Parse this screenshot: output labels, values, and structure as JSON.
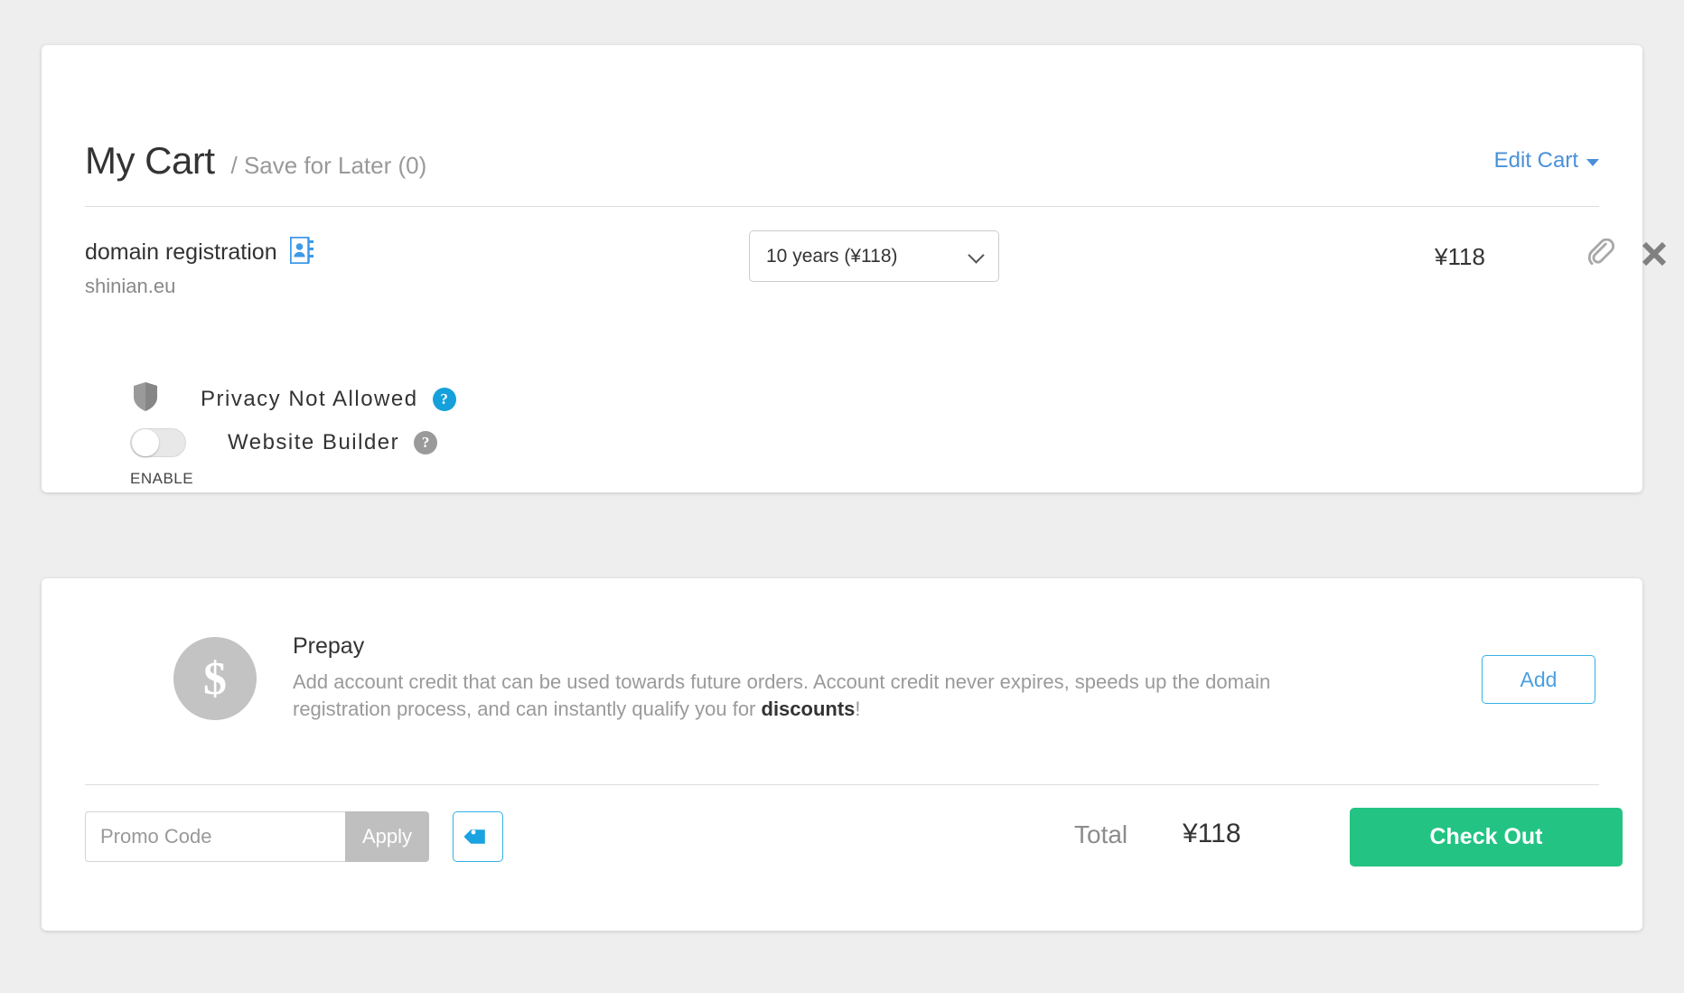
{
  "header": {
    "title": "My Cart",
    "subtitle": "/ Save for Later (0)",
    "edit_cart": "Edit Cart"
  },
  "item": {
    "name": "domain registration",
    "domain": "shinian.eu",
    "term": "10 years (¥118)",
    "price": "¥118",
    "contact_icon": "address-book-icon",
    "attach_icon": "paperclip-icon",
    "remove_icon": "close-icon"
  },
  "options": {
    "privacy": {
      "label": "Privacy  Not  Allowed",
      "help": "?",
      "icon": "shield-icon"
    },
    "website_builder": {
      "label": "Website  Builder",
      "help": "?",
      "toggle_state": "off",
      "enable_label": "ENABLE"
    }
  },
  "prepay": {
    "icon": "dollar-icon",
    "icon_glyph": "$",
    "title": "Prepay",
    "description_part1": "Add account credit that can be used towards future orders. Account credit never expires, speeds up the domain registration process, and can instantly qualify you for ",
    "description_bold": "discounts",
    "description_part2": "!",
    "add_label": "Add"
  },
  "footer": {
    "promo_placeholder": "Promo Code",
    "promo_value": "",
    "apply_label": "Apply",
    "tag_icon": "tag-icon",
    "total_label": "Total",
    "total_value": "¥118",
    "checkout_label": "Check Out"
  },
  "colors": {
    "accent_blue": "#4a90d9",
    "icon_blue": "#3d9ae8",
    "help_blue": "#16a0db",
    "help_gray": "#9a9a9a",
    "green": "#23c383",
    "background": "#eeeeee"
  }
}
